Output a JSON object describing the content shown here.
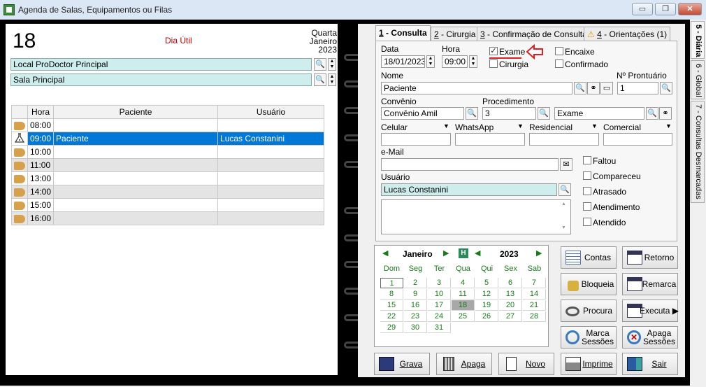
{
  "window": {
    "title": "Agenda de Salas, Equipamentos ou Filas",
    "minimize": "▭",
    "restore": "❐",
    "close": "✕"
  },
  "left": {
    "day": "18",
    "day_type": "Dia Útil",
    "weekday": "Quarta",
    "month": "Janeiro",
    "year": "2023",
    "location": "Local ProDoctor Principal",
    "room": "Sala Principal",
    "columns": {
      "hora": "Hora",
      "paciente": "Paciente",
      "usuario": "Usuário"
    },
    "rows": [
      {
        "hora": "08:00",
        "paciente": "",
        "usuario": ""
      },
      {
        "hora": "09:00",
        "paciente": "Paciente",
        "usuario": "Lucas Constanini"
      },
      {
        "hora": "10:00",
        "paciente": "",
        "usuario": ""
      },
      {
        "hora": "11:00",
        "paciente": "",
        "usuario": ""
      },
      {
        "hora": "13:00",
        "paciente": "",
        "usuario": ""
      },
      {
        "hora": "14:00",
        "paciente": "",
        "usuario": ""
      },
      {
        "hora": "15:00",
        "paciente": "",
        "usuario": ""
      },
      {
        "hora": "16:00",
        "paciente": "",
        "usuario": ""
      }
    ]
  },
  "tabs": [
    {
      "num": "1",
      "label": " - Consulta"
    },
    {
      "num": "2",
      "label": " - Cirurgia"
    },
    {
      "num": "3",
      "label": " - Confirmação de Consultas"
    },
    {
      "num": "4",
      "label": " - Orientações (1)"
    }
  ],
  "form": {
    "data_label": "Data",
    "data_value": "18/01/2023",
    "hora_label": "Hora",
    "hora_value": "09:00",
    "exame": "Exame",
    "cirurgia": "Cirurgia",
    "encaixe": "Encaixe",
    "confirmado": "Confirmado",
    "nome_label": "Nome",
    "nome_value": "Paciente",
    "prontuario_label": "Nº Prontuário",
    "prontuario_value": "1",
    "convenio_label": "Convênio",
    "convenio_value": "Convênio Amil",
    "procedimento_label": "Procedimento",
    "procedimento_code": "3",
    "procedimento_name": "Exame",
    "celular": "Celular",
    "whatsapp": "WhatsApp",
    "residencial": "Residencial",
    "comercial": "Comercial",
    "email_label": "e-Mail",
    "email_value": "",
    "usuario_label": "Usuário",
    "usuario_value": "Lucas Constanini",
    "faltou": "Faltou",
    "compareceu": "Compareceu",
    "atrasado": "Atrasado",
    "atendimento": "Atendimento",
    "atendido": "Atendido"
  },
  "calendar": {
    "month": "Janeiro",
    "year": "2023",
    "today_btn": "H",
    "weekdays": [
      "Dom",
      "Seg",
      "Ter",
      "Qua",
      "Qui",
      "Sex",
      "Sab"
    ],
    "days": [
      "1",
      "2",
      "3",
      "4",
      "5",
      "6",
      "7",
      "8",
      "9",
      "10",
      "11",
      "12",
      "13",
      "14",
      "15",
      "16",
      "17",
      "18",
      "19",
      "20",
      "21",
      "22",
      "23",
      "24",
      "25",
      "26",
      "27",
      "28",
      "29",
      "30",
      "31"
    ],
    "selected": "18"
  },
  "buttons": {
    "contas": "Contas",
    "retorno": "Retorno",
    "bloqueia": "Bloqueia",
    "remarca": "Remarca",
    "procura": "Procura",
    "executa": "Executa",
    "marca_1": "Marca",
    "marca_2": "Sessões",
    "apaga_sessoes_1": "Apaga",
    "apaga_sessoes_2": "Sessões",
    "grava": "Grava",
    "apaga": "Apaga",
    "novo": "Novo",
    "imprime": "Imprime",
    "sair": "Sair"
  },
  "side_tabs": [
    "5 - Diária",
    "6 - Global",
    "7 - Consultas Desmarcadas"
  ]
}
